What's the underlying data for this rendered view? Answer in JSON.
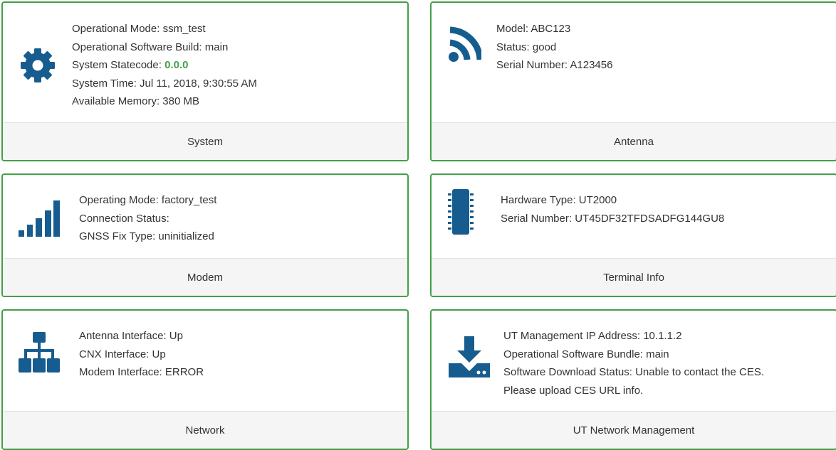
{
  "colors": {
    "border": "#43a047",
    "icon": "#175c8f",
    "statecode": "#43a047"
  },
  "cards": {
    "system": {
      "icon": "gear-icon",
      "lines": {
        "op_mode": "Operational Mode: ssm_test",
        "sw_build": "Operational Software Build: main",
        "statecode_label": "System Statecode: ",
        "statecode_value": "0.0.0",
        "system_time": "System Time: Jul 11, 2018, 9:30:55 AM",
        "memory": "Available Memory: 380 MB"
      },
      "footer": "System"
    },
    "antenna": {
      "icon": "rss-icon",
      "lines": [
        "Model: ABC123",
        "Status: good",
        "Serial Number: A123456"
      ],
      "footer": "Antenna"
    },
    "modem": {
      "icon": "signal-bars-icon",
      "lines": [
        "Operating Mode: factory_test",
        "Connection Status:",
        "GNSS Fix Type: uninitialized"
      ],
      "footer": "Modem"
    },
    "terminal": {
      "icon": "chip-icon",
      "lines": [
        "Hardware Type: UT2000",
        "Serial Number: UT45DF32TFDSADFG144GU8"
      ],
      "footer": "Terminal Info"
    },
    "network": {
      "icon": "network-tree-icon",
      "lines": [
        "Antenna Interface: Up",
        "CNX Interface: Up",
        "Modem Interface: ERROR"
      ],
      "footer": "Network"
    },
    "ut_network": {
      "icon": "download-icon",
      "lines": [
        "UT Management IP Address: 10.1.1.2",
        "Operational Software Bundle: main",
        "Software Download Status: Unable to contact the CES.",
        "Please upload CES URL info."
      ],
      "footer": "UT Network Management"
    }
  }
}
